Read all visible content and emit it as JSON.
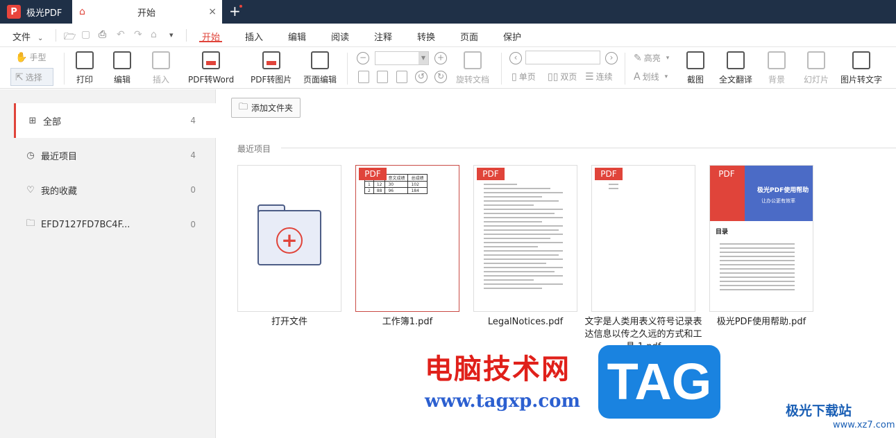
{
  "app": {
    "name": "极光PDF",
    "logo_letter": "P"
  },
  "tab": {
    "title": "开始",
    "close": "×"
  },
  "new_tab": "+",
  "menu": {
    "file": "文件",
    "tabs": [
      "开始",
      "插入",
      "编辑",
      "阅读",
      "注释",
      "转换",
      "页面",
      "保护"
    ],
    "active_tab": "开始"
  },
  "toolbar": {
    "hand": "手型",
    "select": "选择",
    "print": "打印",
    "edit": "编辑",
    "insert": "插入",
    "pdf_to_word": "PDF转Word",
    "pdf_to_image": "PDF转图片",
    "page_edit": "页面编辑",
    "rotate_doc": "旋转文档",
    "single_page": "单页",
    "double_page": "双页",
    "continuous": "连续",
    "highlight": "高亮",
    "underline": "划线",
    "screenshot": "截图",
    "full_translate": "全文翻译",
    "background": "背景",
    "slideshow": "幻灯片",
    "image_to_text": "图片转文字"
  },
  "sidebar": {
    "items": [
      {
        "label": "全部",
        "count": "4",
        "icon": "grid-icon"
      },
      {
        "label": "最近项目",
        "count": "4",
        "icon": "clock-icon"
      },
      {
        "label": "我的收藏",
        "count": "0",
        "icon": "heart-icon"
      },
      {
        "label": "EFD7127FD7BC4F...",
        "count": "0",
        "icon": "folder-icon"
      }
    ]
  },
  "main": {
    "add_folder": "添加文件夹",
    "recent_label": "最近项目",
    "pdf_badge": "PDF",
    "files": [
      {
        "name": "打开文件"
      },
      {
        "name": "工作簿1.pdf"
      },
      {
        "name": "LegalNotices.pdf"
      },
      {
        "name": "文字是人类用表义符号记录表达信息以传之久远的方式和工具 1.pdf"
      },
      {
        "name": "极光PDF使用帮助.pdf"
      }
    ],
    "mini_table": [
      [
        "",
        "",
        "意文成绩",
        "总成绩"
      ],
      [
        "1",
        "12",
        "30",
        "102"
      ],
      [
        "2",
        "88",
        "96",
        "184"
      ]
    ],
    "help_cover": {
      "title": "极光PDF使用帮助",
      "subtitle": "让办公更有效率",
      "toc": "目录"
    }
  },
  "watermark": {
    "cn": "电脑技术网",
    "url": "www.tagxp.com",
    "tag": "TAG",
    "site_name": "极光下载站",
    "site_url": "www.xz7.com"
  }
}
